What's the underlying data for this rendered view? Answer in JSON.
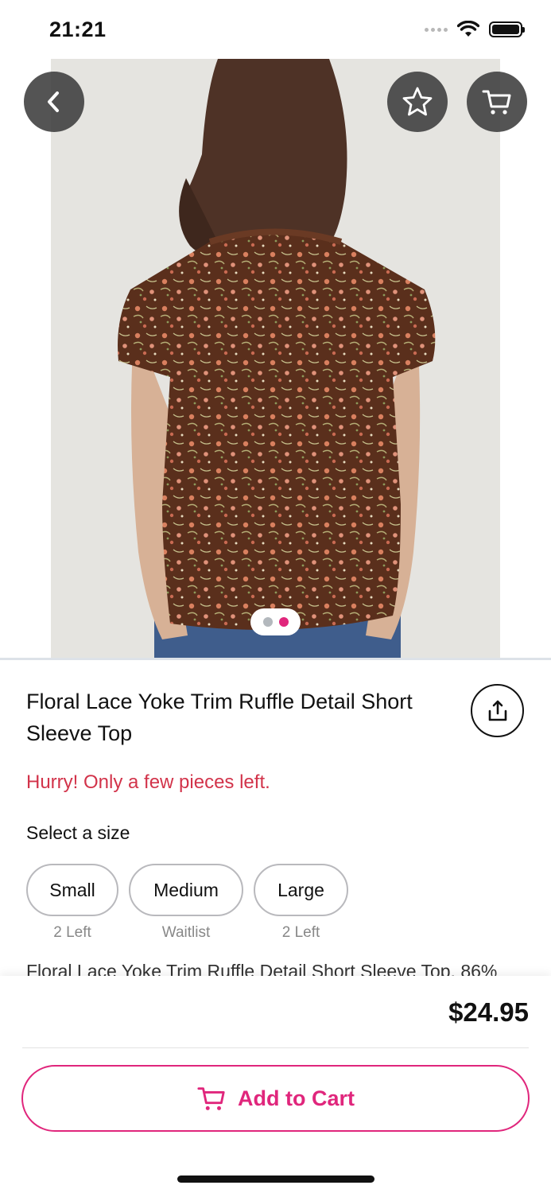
{
  "status_bar": {
    "time": "21:21"
  },
  "product": {
    "title": "Floral Lace Yoke Trim Ruffle Detail Short Sleeve Top",
    "stock_warning": "Hurry! Only a few pieces left.",
    "size_label": "Select a size",
    "sizes": [
      {
        "label": "Small",
        "availability": "2 Left"
      },
      {
        "label": "Medium",
        "availability": "Waitlist"
      },
      {
        "label": "Large",
        "availability": "2 Left"
      }
    ],
    "description": "Floral Lace Yoke Trim Ruffle Detail Short Sleeve Top. 86%",
    "image_pages": {
      "count": 2,
      "active": 2
    }
  },
  "purchase": {
    "price": "$24.95",
    "add_to_cart_label": "Add to Cart"
  },
  "icons": {
    "back": "chevron-left-icon",
    "favorite": "star-icon",
    "cart": "cart-icon",
    "share": "share-icon"
  },
  "colors": {
    "accent": "#e0267c",
    "warning": "#d2334a",
    "page_dot_inactive": "#b3b8bd",
    "page_dot_active": "#e0267c",
    "shirt": "#5a2f1c",
    "background_image": "#e5e4e0"
  }
}
